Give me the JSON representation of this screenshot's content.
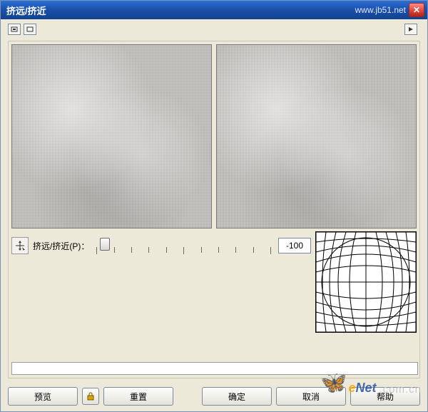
{
  "titlebar": {
    "title": "挤远/挤近",
    "url": "www.jb51.net",
    "close_glyph": "✕"
  },
  "controls": {
    "slider_label": "挤远/挤近(P)：",
    "slider_value": "-100",
    "slider_min": -100,
    "slider_max": 100,
    "slider_position_pct": 2
  },
  "buttons": {
    "preview": "预览",
    "reset": "重置",
    "ok": "确定",
    "cancel": "取消",
    "help": "帮助"
  },
  "icons": {
    "collapse": "collapse-icon",
    "expand": "expand-icon",
    "flyout": "flyout-menu-icon",
    "move_tool": "move-tool-icon",
    "lock": "lock-icon",
    "close": "close-icon"
  },
  "watermark": {
    "logo_e": "e",
    "logo_net": "Net",
    "suffix": ".com.cn"
  }
}
